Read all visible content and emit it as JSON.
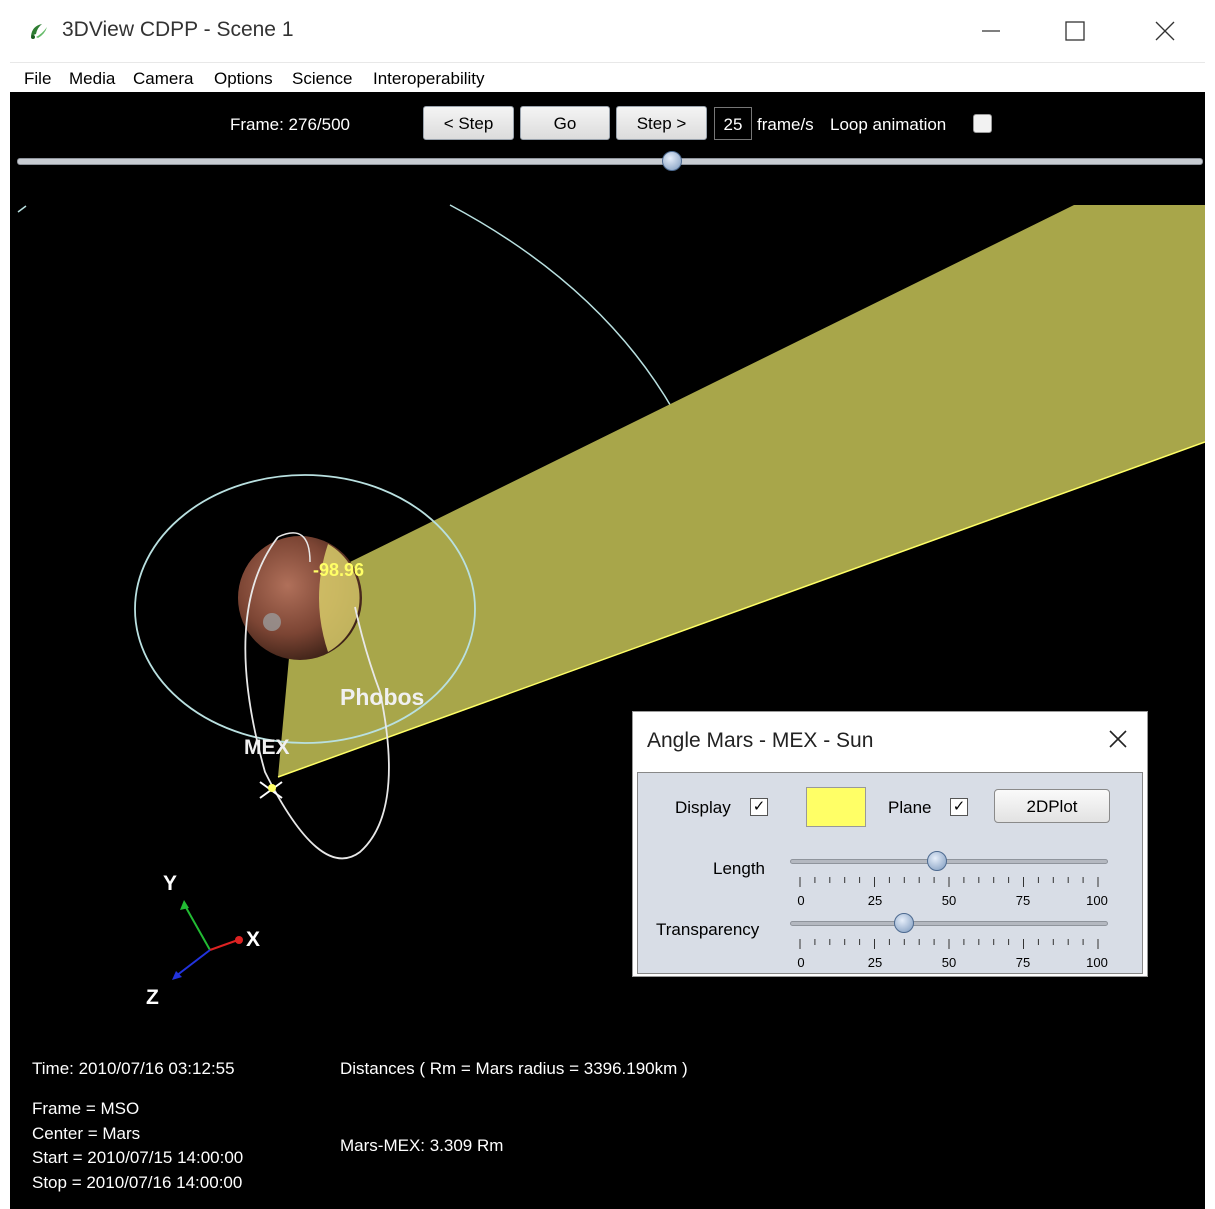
{
  "window": {
    "title": "3DView CDPP - Scene 1"
  },
  "menu": [
    "File",
    "Media",
    "Camera",
    "Options",
    "Science",
    "Interoperability"
  ],
  "animation": {
    "frame_label": "Frame: 276/500",
    "frame_current": 276,
    "frame_total": 500,
    "step_back_label": "< Step",
    "go_label": "Go",
    "step_forward_label": "Step >",
    "fps_value": "25",
    "fps_unit": "frame/s",
    "loop_label": "Loop animation",
    "loop_checked": false
  },
  "scene": {
    "angle_value": "-98.96",
    "phobos_label": "Phobos",
    "mex_label": "MEX",
    "axes": {
      "x": "X",
      "y": "Y",
      "z": "Z"
    },
    "plane_color": "#a8a64a",
    "orbit_color": "#b9e0e0",
    "angle_color": "#ffff66"
  },
  "info": {
    "time": "Time: 2010/07/16 03:12:55",
    "frame": "Frame = MSO",
    "center": "Center = Mars",
    "start": "Start = 2010/07/15 14:00:00",
    "stop": "Stop = 2010/07/16 14:00:00",
    "distances_header": "Distances ( Rm = Mars radius = 3396.190km )",
    "distance_mars_mex": "Mars-MEX: 3.309 Rm"
  },
  "angle_panel": {
    "title": "Angle Mars - MEX - Sun",
    "display_label": "Display",
    "display_checked": true,
    "plane_label": "Plane",
    "plane_checked": true,
    "color": "#ffff66",
    "plot_button": "2DPlot",
    "length_label": "Length",
    "length_value": 46,
    "transparency_label": "Transparency",
    "transparency_value": 35,
    "ticks": [
      "0",
      "25",
      "50",
      "75",
      "100"
    ]
  }
}
